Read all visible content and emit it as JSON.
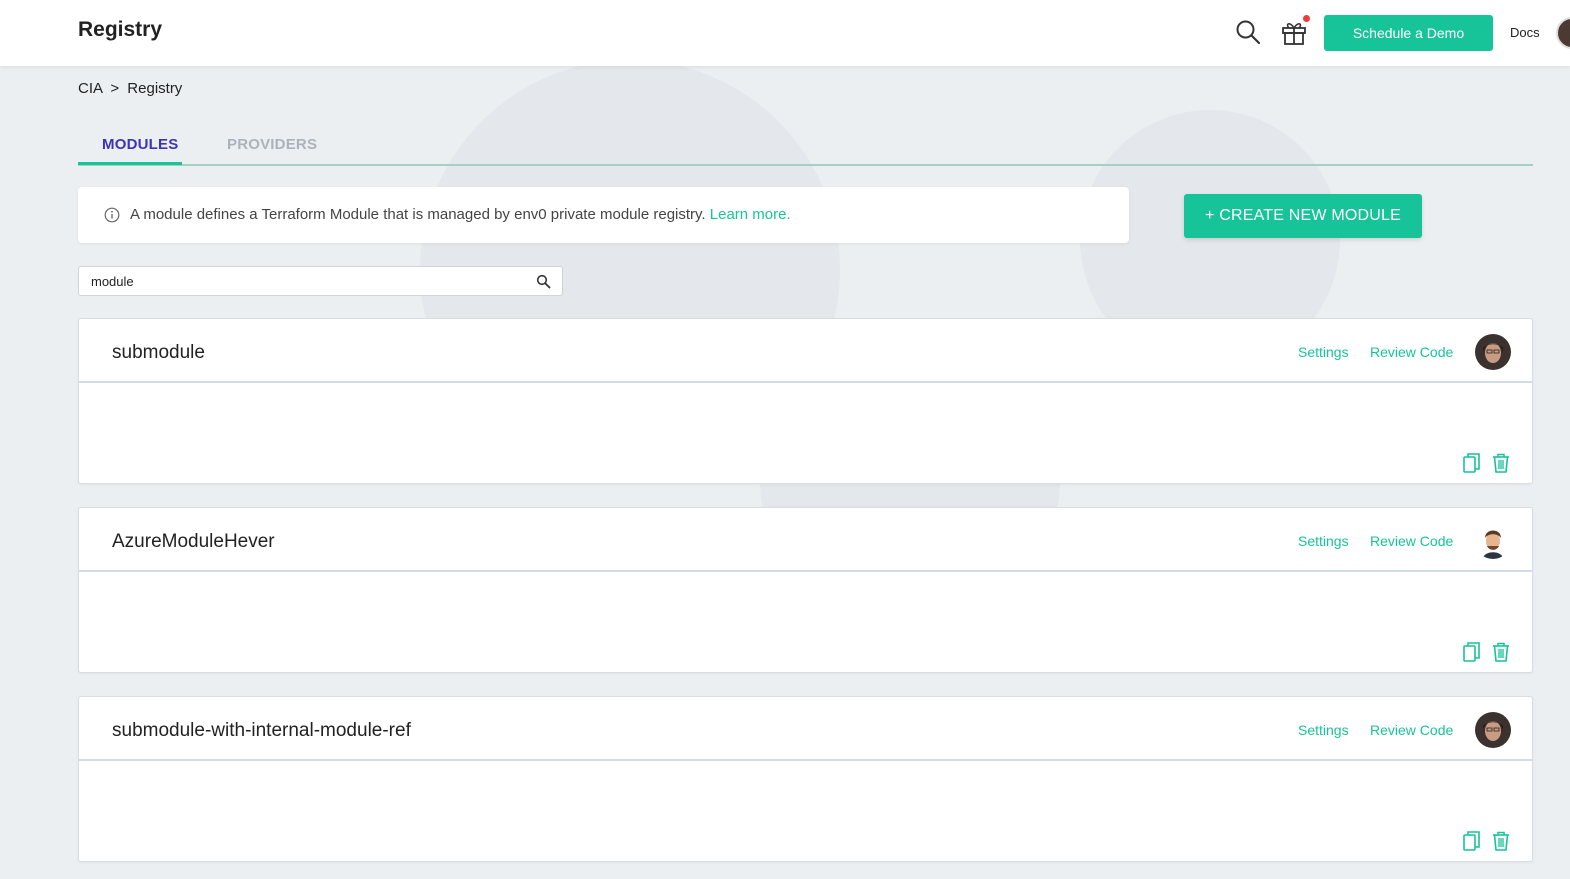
{
  "header": {
    "title": "Registry",
    "demo_button": "Schedule a Demo",
    "docs": "Docs"
  },
  "breadcrumb": {
    "org": "CIA",
    "separator": ">",
    "current": "Registry"
  },
  "tabs": [
    {
      "label": "MODULES",
      "active": true
    },
    {
      "label": "PROVIDERS",
      "active": false
    }
  ],
  "info": {
    "text": "A module defines a Terraform Module that is managed by env0 private module registry.",
    "link": "Learn more."
  },
  "create_button": "+ CREATE NEW MODULE",
  "search": {
    "value": "module"
  },
  "modules": [
    {
      "name": "submodule",
      "settings": "Settings",
      "review": "Review Code"
    },
    {
      "name": "AzureModuleHever",
      "settings": "Settings",
      "review": "Review Code"
    },
    {
      "name": "submodule-with-internal-module-ref",
      "settings": "Settings",
      "review": "Review Code"
    }
  ],
  "colors": {
    "accent": "#17c499",
    "active_tab": "#3a35b8",
    "inactive_tab": "#aab3bd",
    "notification": "#ef3b3b"
  },
  "icons": {
    "search": "search-icon",
    "gift": "gift-icon",
    "info": "info-icon",
    "copy": "copy-icon",
    "delete": "trash-icon"
  }
}
